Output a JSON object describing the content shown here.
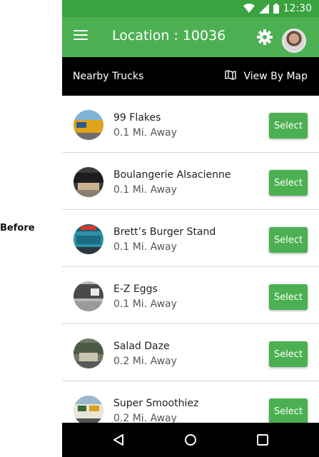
{
  "side_label": "Before",
  "status_bar": {
    "time": "12:30"
  },
  "app_bar": {
    "title": "Location : 10036"
  },
  "sub_bar": {
    "left_label": "Nearby Trucks",
    "map_label": "View By Map"
  },
  "trucks": [
    {
      "name": "99 Flakes",
      "distance": "0.1 Mi. Away",
      "button": "Select"
    },
    {
      "name": "Boulangerie Alsacienne",
      "distance": "0.1 Mi. Away",
      "button": "Select"
    },
    {
      "name": "Brett’s Burger Stand",
      "distance": "0.1 Mi. Away",
      "button": "Select"
    },
    {
      "name": "E-Z Eggs",
      "distance": "0.1 Mi. Away",
      "button": "Select"
    },
    {
      "name": "Salad Daze",
      "distance": "0.2 Mi. Away",
      "button": "Select"
    },
    {
      "name": "Super Smoothiez",
      "distance": "0.2 Mi. Away",
      "button": "Select"
    }
  ],
  "colors": {
    "accent": "#4cb052",
    "status_bar": "#3aa23f",
    "sub_bar": "#000000"
  },
  "icons": [
    "menu-icon",
    "gear-icon",
    "map-icon",
    "back-icon",
    "home-icon",
    "recents-icon",
    "wifi-icon",
    "signal-icon",
    "battery-icon"
  ]
}
